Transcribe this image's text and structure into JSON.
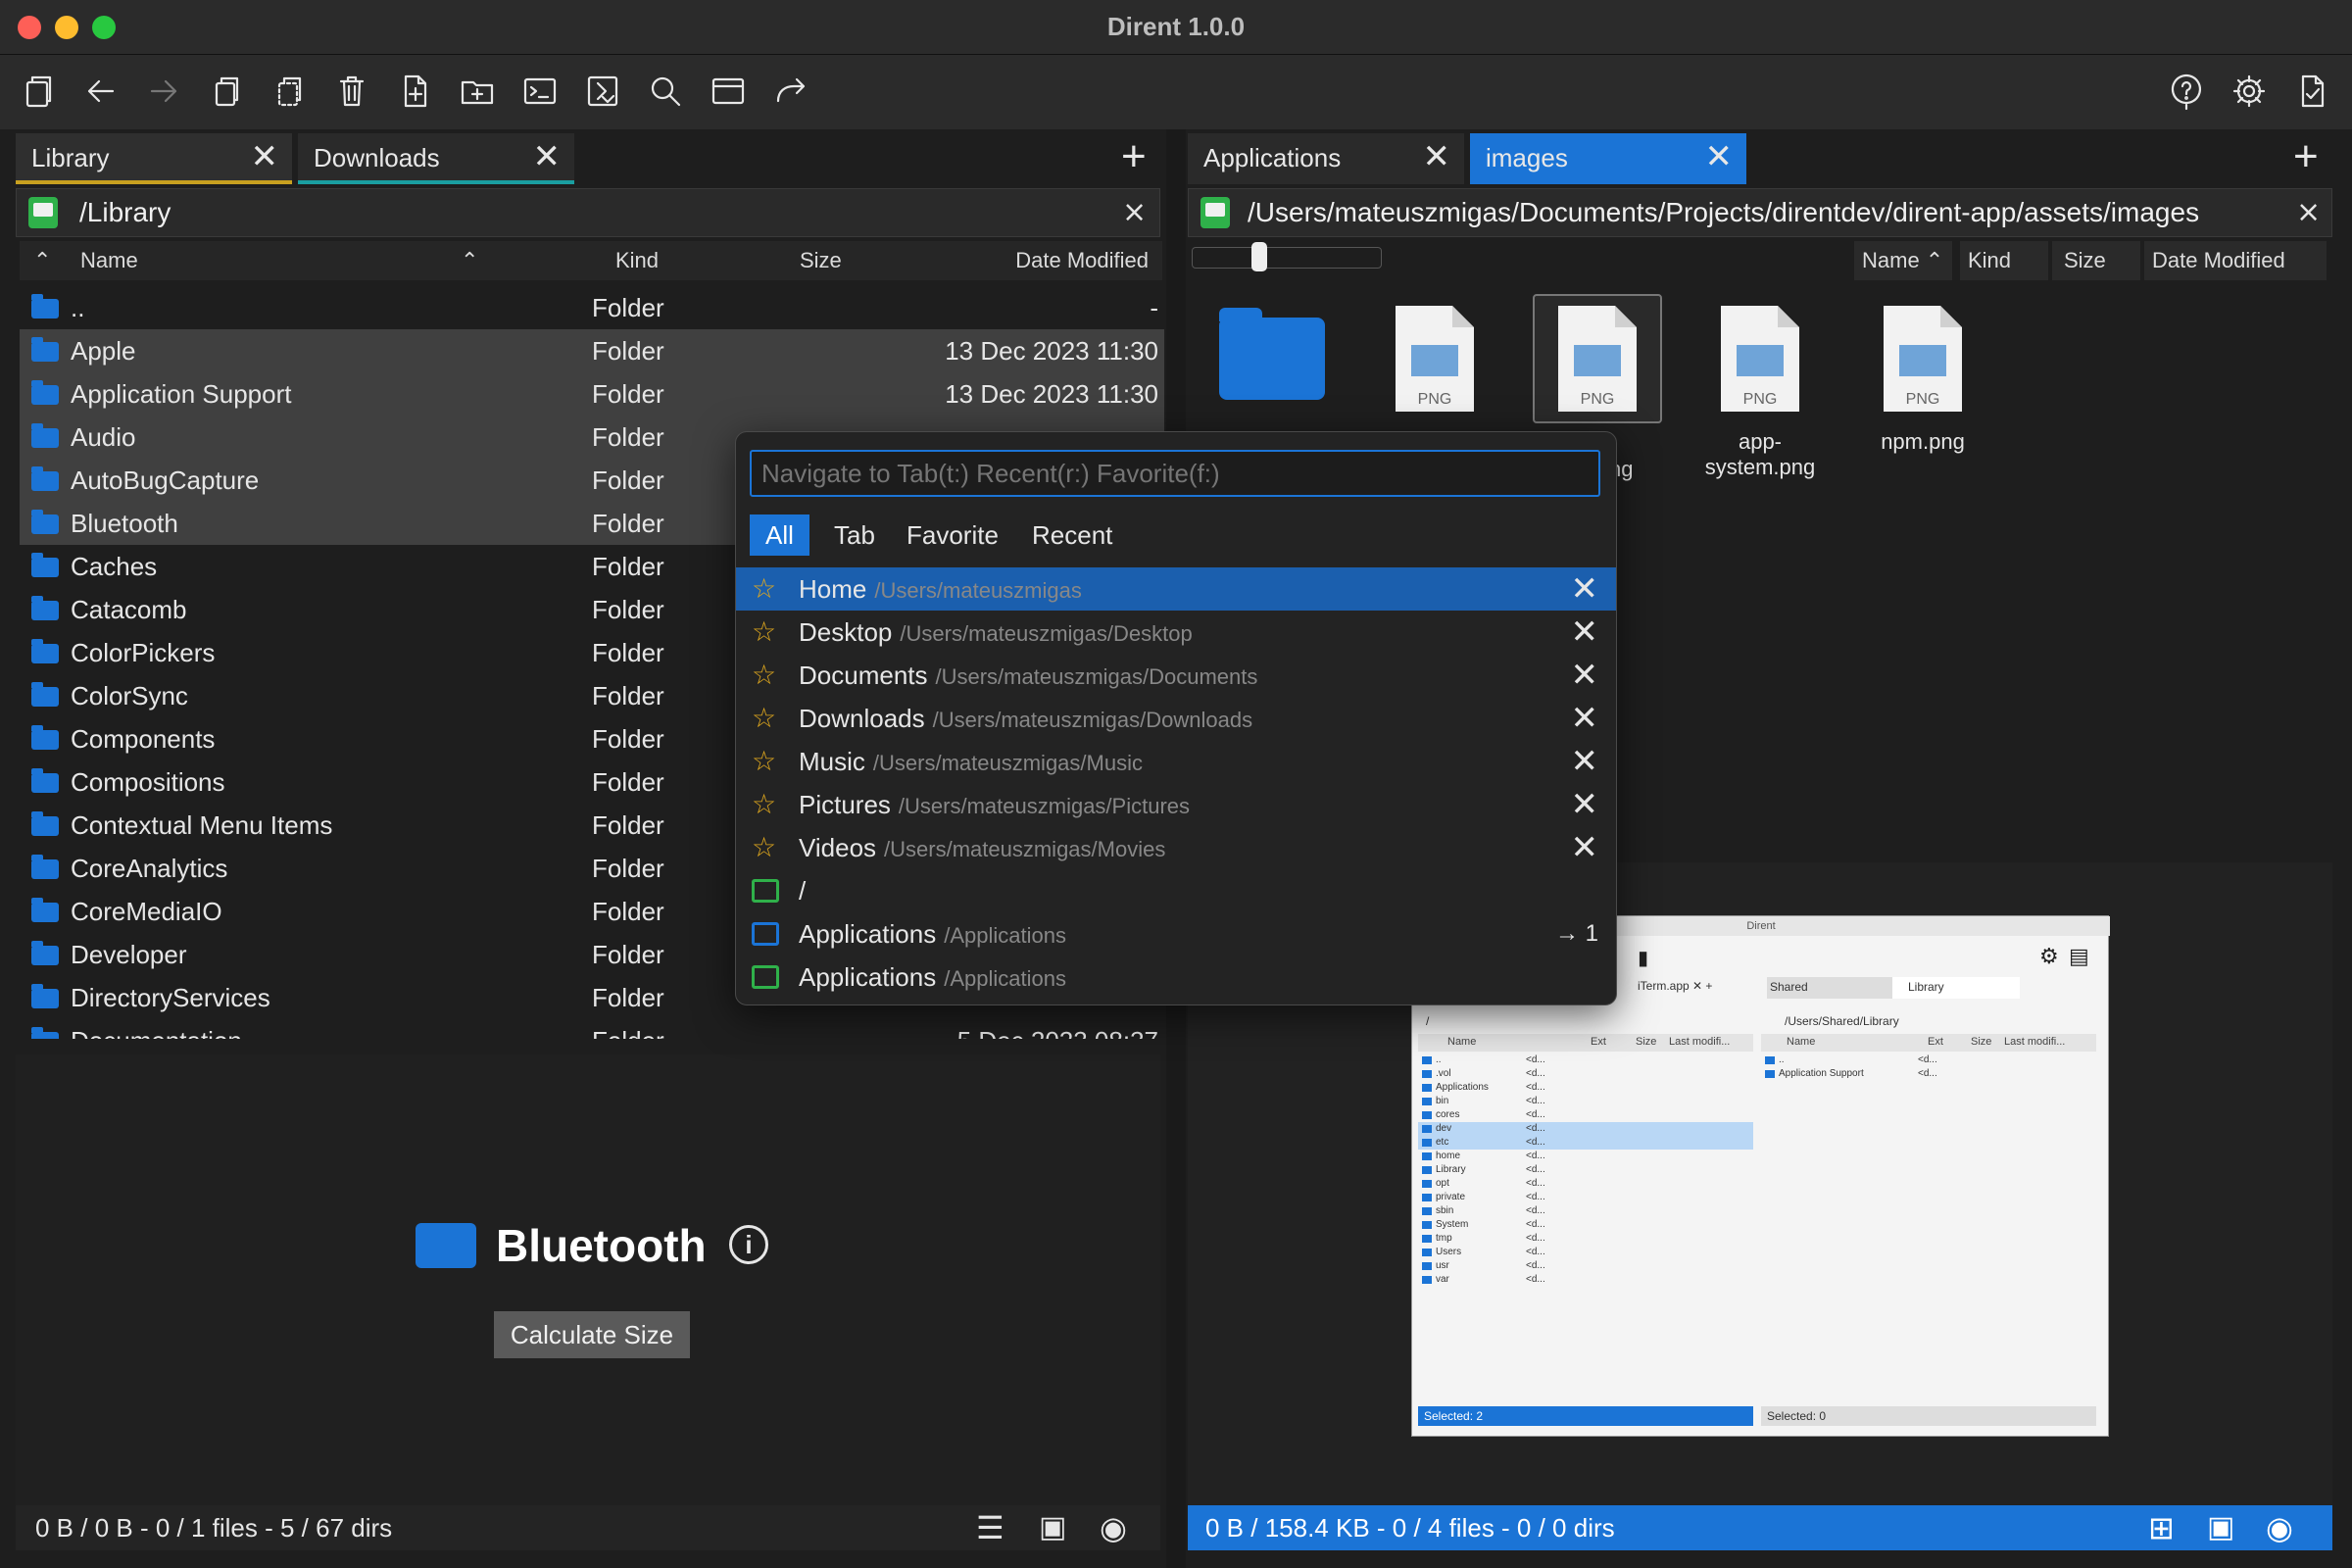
{
  "window": {
    "title": "Dirent 1.0.0"
  },
  "left_pane": {
    "tabs": [
      {
        "label": "Library",
        "active": true
      },
      {
        "label": "Downloads",
        "active": false
      }
    ],
    "path": "/Library",
    "columns": [
      "Name",
      "Kind",
      "Size",
      "Date Modified"
    ],
    "rows": [
      {
        "name": "..",
        "kind": "Folder",
        "date": "-",
        "selected": false
      },
      {
        "name": "Apple",
        "kind": "Folder",
        "date": "13 Dec 2023 11:30",
        "selected": true
      },
      {
        "name": "Application Support",
        "kind": "Folder",
        "date": "13 Dec 2023 11:30",
        "selected": true
      },
      {
        "name": "Audio",
        "kind": "Folder",
        "date": "",
        "selected": true
      },
      {
        "name": "AutoBugCapture",
        "kind": "Folder",
        "date": "",
        "selected": true
      },
      {
        "name": "Bluetooth",
        "kind": "Folder",
        "date": "",
        "selected": true
      },
      {
        "name": "Caches",
        "kind": "Folder",
        "date": "",
        "selected": false
      },
      {
        "name": "Catacomb",
        "kind": "Folder",
        "date": "",
        "selected": false
      },
      {
        "name": "ColorPickers",
        "kind": "Folder",
        "date": "",
        "selected": false
      },
      {
        "name": "ColorSync",
        "kind": "Folder",
        "date": "",
        "selected": false
      },
      {
        "name": "Components",
        "kind": "Folder",
        "date": "",
        "selected": false
      },
      {
        "name": "Compositions",
        "kind": "Folder",
        "date": "",
        "selected": false
      },
      {
        "name": "Contextual Menu Items",
        "kind": "Folder",
        "date": "",
        "selected": false
      },
      {
        "name": "CoreAnalytics",
        "kind": "Folder",
        "date": "",
        "selected": false
      },
      {
        "name": "CoreMediaIO",
        "kind": "Folder",
        "date": "",
        "selected": false
      },
      {
        "name": "Developer",
        "kind": "Folder",
        "date": "",
        "selected": false
      },
      {
        "name": "DirectoryServices",
        "kind": "Folder",
        "date": "",
        "selected": false
      },
      {
        "name": "Documentation",
        "kind": "Folder",
        "date": "5 Dec 2023 08:37",
        "selected": false
      }
    ],
    "preview": {
      "name": "Bluetooth",
      "button": "Calculate Size"
    },
    "status": "0 B / 0 B - 0 / 1 files - 5 / 67 dirs"
  },
  "right_pane": {
    "tabs": [
      {
        "label": "Applications",
        "active": false
      },
      {
        "label": "images",
        "active": true
      }
    ],
    "path": "/Users/mateuszmigas/Documents/Projects/direntdev/dirent-app/assets/images",
    "sort_columns": [
      "Name",
      "Kind",
      "Size",
      "Date Modified"
    ],
    "zoom_slider": 0.15,
    "items": [
      {
        "name": "",
        "type": "folder"
      },
      {
        "name": "",
        "type": "png",
        "badge": "PNG"
      },
      {
        "name": "",
        "type": "png",
        "badge": "PNG",
        "selected": true
      },
      {
        "name": "app-system.png",
        "type": "png",
        "badge": "PNG"
      },
      {
        "name": "npm.png",
        "type": "png",
        "badge": "PNG"
      }
    ],
    "partial_label": "ng",
    "status": "0 B / 158.4 KB - 0 / 4 files - 0 / 0 dirs"
  },
  "preview_thumb": {
    "title": "Dirent",
    "left_tabs": [
      "iTerm.app"
    ],
    "right_tabs": [
      "Shared",
      "Library"
    ],
    "left_path": "/",
    "right_path": "/Users/Shared/Library",
    "left_cols": [
      "Name",
      "Ext",
      "Size",
      "Last modifi..."
    ],
    "right_cols": [
      "Name",
      "Ext",
      "Size",
      "Last modifi..."
    ],
    "left_rows": [
      "..",
      ".vol",
      "Applications",
      "bin",
      "cores",
      "dev",
      "etc",
      "home",
      "Library",
      "opt",
      "private",
      "sbin",
      "System",
      "tmp",
      "Users",
      "usr",
      "var"
    ],
    "left_ext": "<d...",
    "right_rows": [
      "..",
      "Application Support"
    ],
    "left_status": "Selected: 2",
    "right_status": "Selected: 0"
  },
  "navigator": {
    "placeholder": "Navigate to Tab(t:) Recent(r:) Favorite(f:)",
    "filters": [
      "All",
      "Tab",
      "Favorite",
      "Recent"
    ],
    "items": [
      {
        "label": "Home",
        "path": "/Users/mateuszmigas",
        "kind": "favorite",
        "action": "close"
      },
      {
        "label": "Desktop",
        "path": "/Users/mateuszmigas/Desktop",
        "kind": "favorite",
        "action": "close"
      },
      {
        "label": "Documents",
        "path": "/Users/mateuszmigas/Documents",
        "kind": "favorite",
        "action": "close"
      },
      {
        "label": "Downloads",
        "path": "/Users/mateuszmigas/Downloads",
        "kind": "favorite",
        "action": "close"
      },
      {
        "label": "Music",
        "path": "/Users/mateuszmigas/Music",
        "kind": "favorite",
        "action": "close"
      },
      {
        "label": "Pictures",
        "path": "/Users/mateuszmigas/Pictures",
        "kind": "favorite",
        "action": "close"
      },
      {
        "label": "Videos",
        "path": "/Users/mateuszmigas/Movies",
        "kind": "favorite",
        "action": "close"
      },
      {
        "label": "/",
        "path": "",
        "kind": "drive",
        "action": ""
      },
      {
        "label": "Applications",
        "path": "/Applications",
        "kind": "tab",
        "action": "→ 1"
      },
      {
        "label": "Applications",
        "path": "/Applications",
        "kind": "drive",
        "action": ""
      }
    ]
  },
  "colors": {
    "accent": "#1b74d6",
    "selection": "#1b5fae",
    "star": "#e0a81e",
    "drive": "#2fb14a"
  }
}
